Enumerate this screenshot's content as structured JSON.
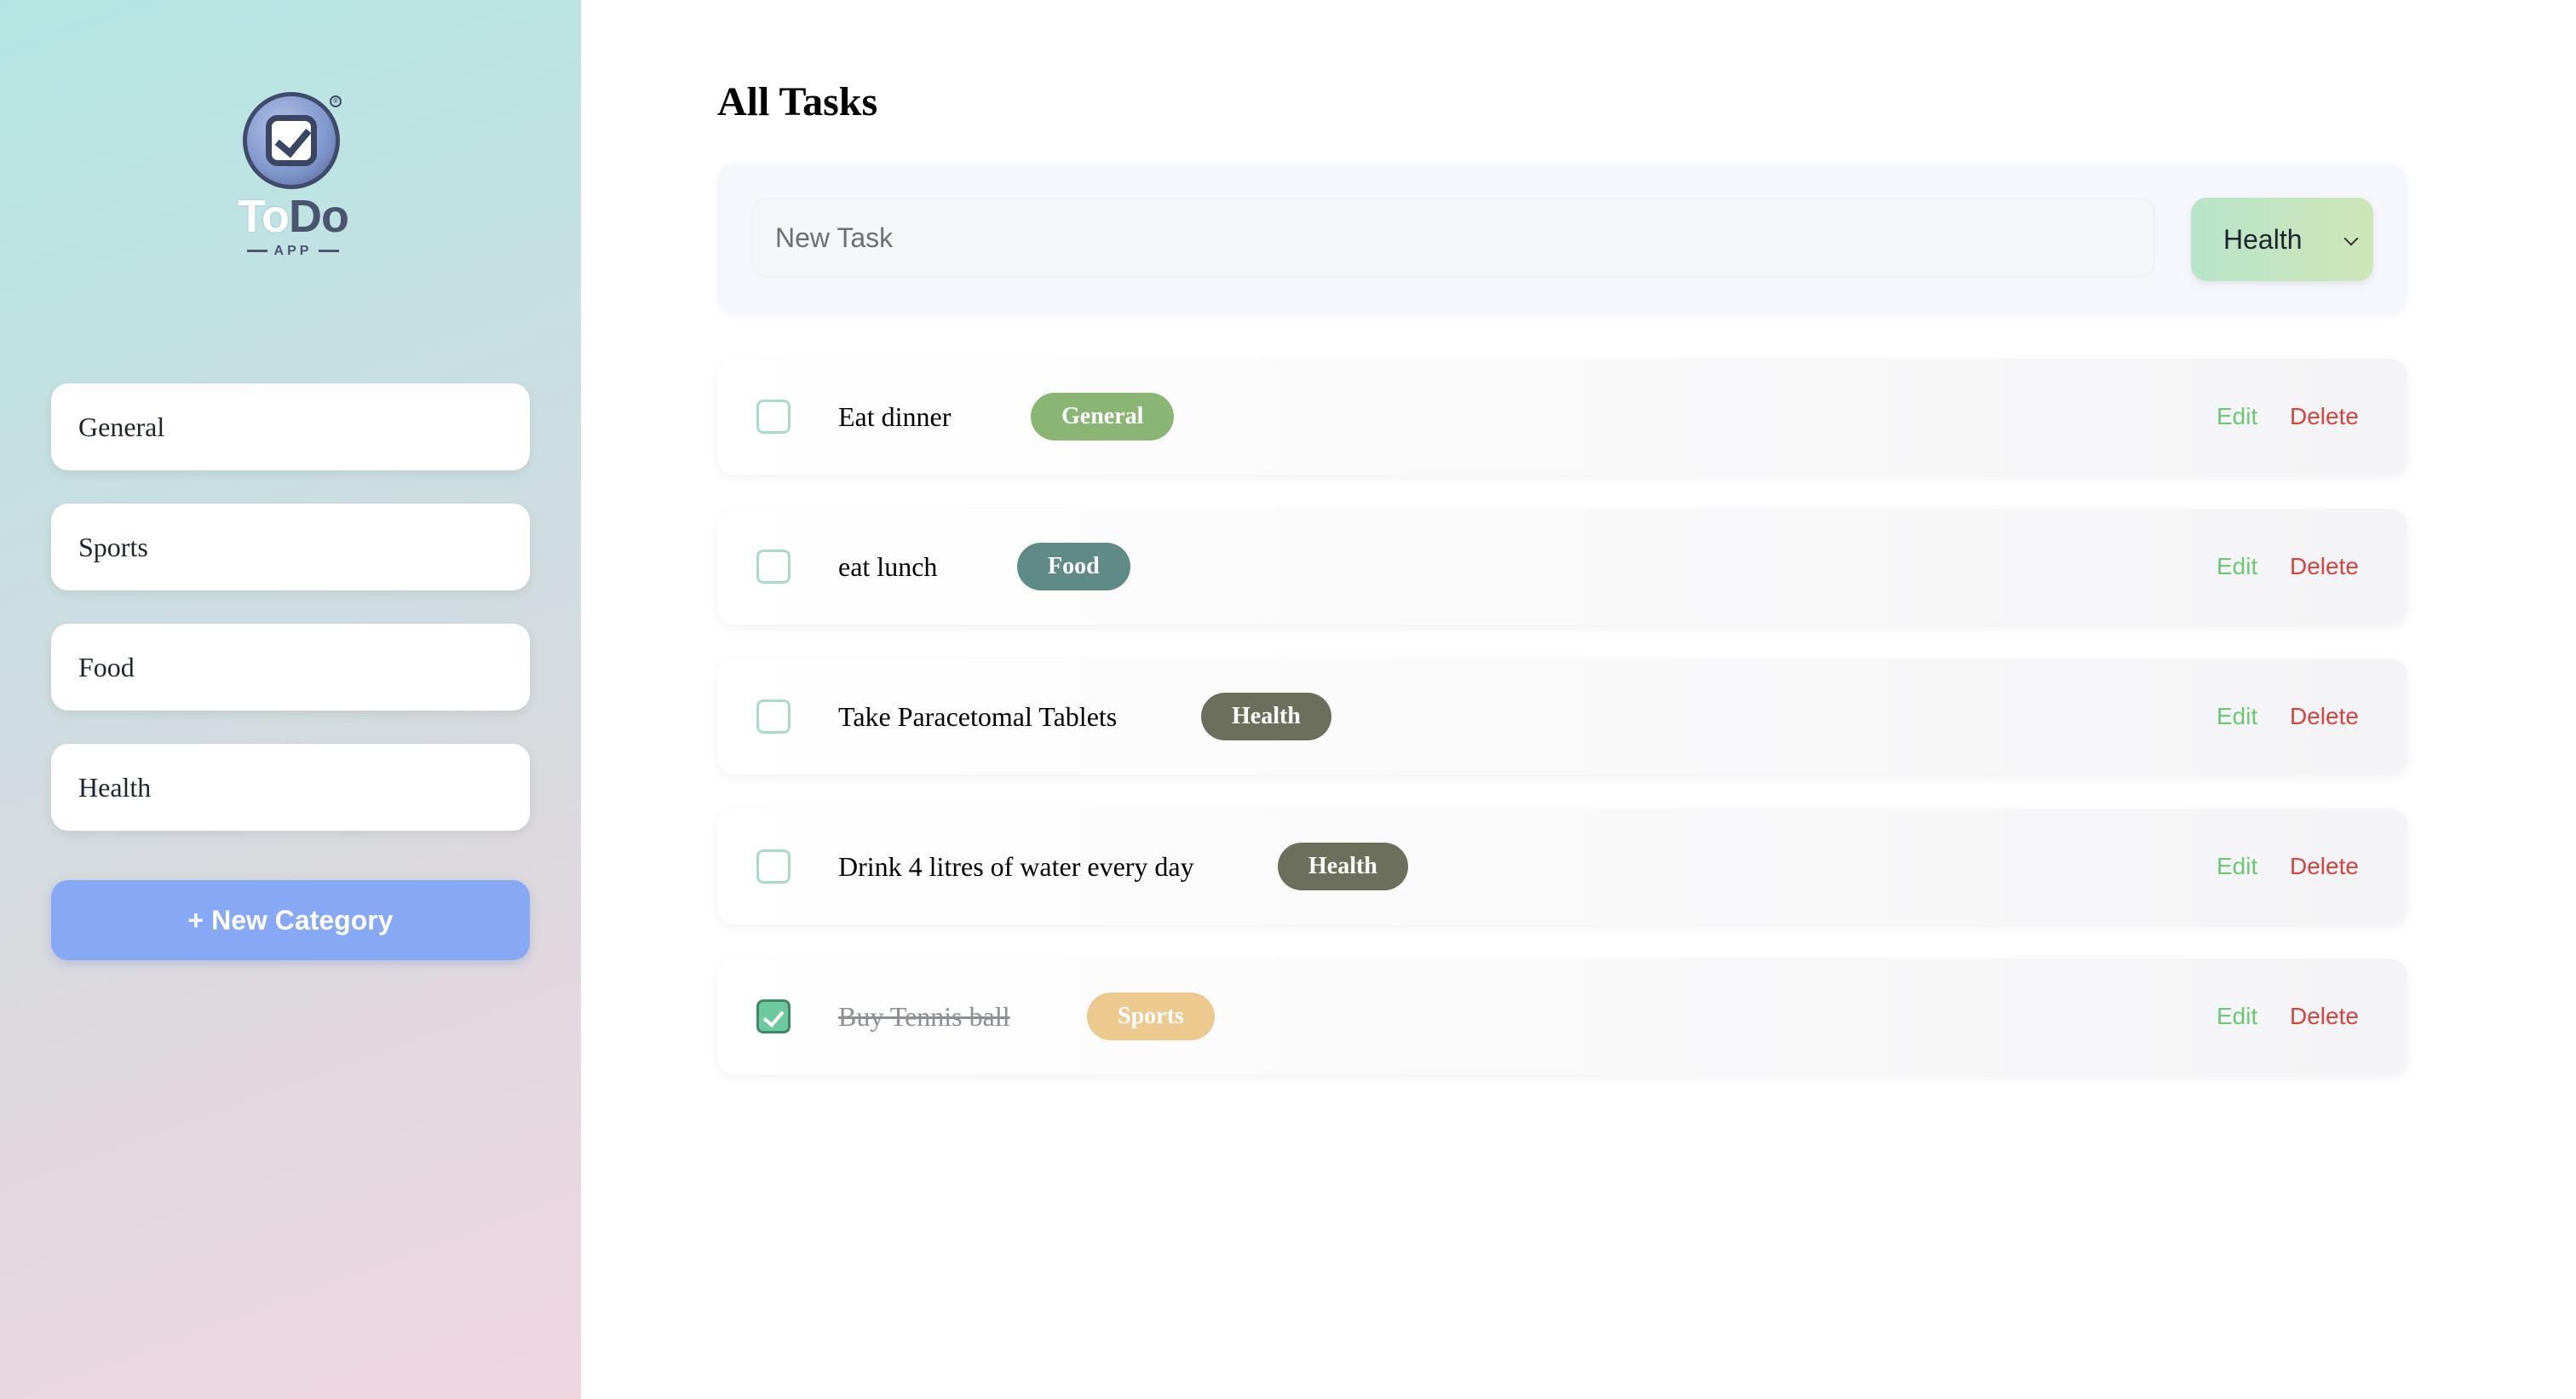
{
  "logo": {
    "word_to": "To",
    "word_do": "Do",
    "sub": "APP",
    "reg": "®"
  },
  "sidebar": {
    "categories": [
      {
        "label": "General"
      },
      {
        "label": "Sports"
      },
      {
        "label": "Food"
      },
      {
        "label": "Health"
      }
    ],
    "new_category_label": "+ New Category"
  },
  "main": {
    "title": "All Tasks",
    "new_task_placeholder": "New Task",
    "selected_category": "Health",
    "edit_label": "Edit",
    "delete_label": "Delete"
  },
  "tasks": [
    {
      "text": "Eat dinner",
      "category": "General",
      "done": false,
      "badge_color": "#8ab574"
    },
    {
      "text": "eat lunch",
      "category": "Food",
      "done": false,
      "badge_color": "#5f8a85"
    },
    {
      "text": "Take Paracetomal Tablets",
      "category": "Health",
      "done": false,
      "badge_color": "#6b6f5c"
    },
    {
      "text": "Drink 4 litres of water every day",
      "category": "Health",
      "done": false,
      "badge_color": "#6b6f5c"
    },
    {
      "text": "Buy Tennis ball",
      "category": "Sports",
      "done": true,
      "badge_color": "#ecc98e"
    }
  ],
  "colors": {
    "accent_button": "#86a8f5",
    "edit": "#6cc77a",
    "delete": "#d64242",
    "checkbox_border": "#a8dcc4"
  },
  "icons": {
    "logo": "todo-check-icon",
    "select": "chevron-down-icon",
    "checked": "checkmark-icon"
  }
}
